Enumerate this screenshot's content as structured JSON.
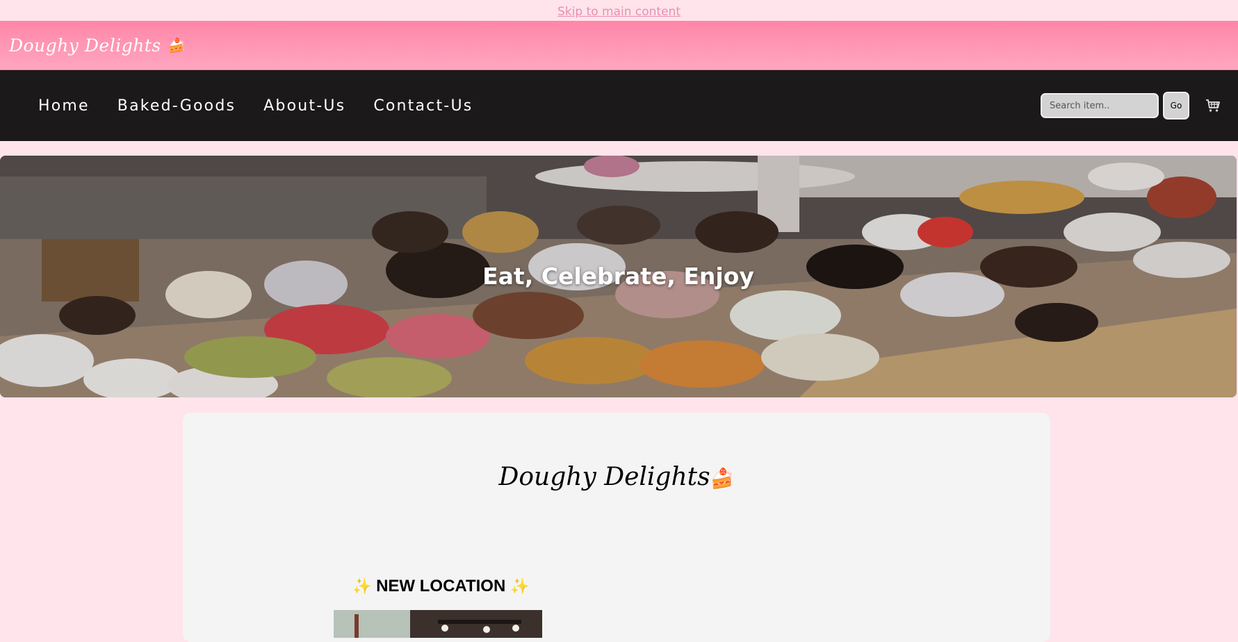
{
  "skip_link": "Skip to main content",
  "brand": {
    "name": "Doughy Delights",
    "emoji": "🍰"
  },
  "nav": {
    "items": [
      {
        "label": "Home"
      },
      {
        "label": "Baked-Goods"
      },
      {
        "label": "About-Us"
      },
      {
        "label": "Contact-Us"
      }
    ],
    "search_placeholder": "Search item..",
    "go_label": "Go",
    "cart_icon": "cart-icon"
  },
  "hero": {
    "title": "Eat, Celebrate, Enjoy"
  },
  "main": {
    "title": "Doughy Delights",
    "title_emoji": "🍰",
    "location": {
      "sparkle_left": "✨",
      "label": "NEW LOCATION",
      "sparkle_right": "✨"
    }
  },
  "colors": {
    "page_bg": "#ffe4ec",
    "brand_bar": "#ff8fae",
    "navbar": "#1b191a",
    "card_bg": "#f4f4f4"
  }
}
